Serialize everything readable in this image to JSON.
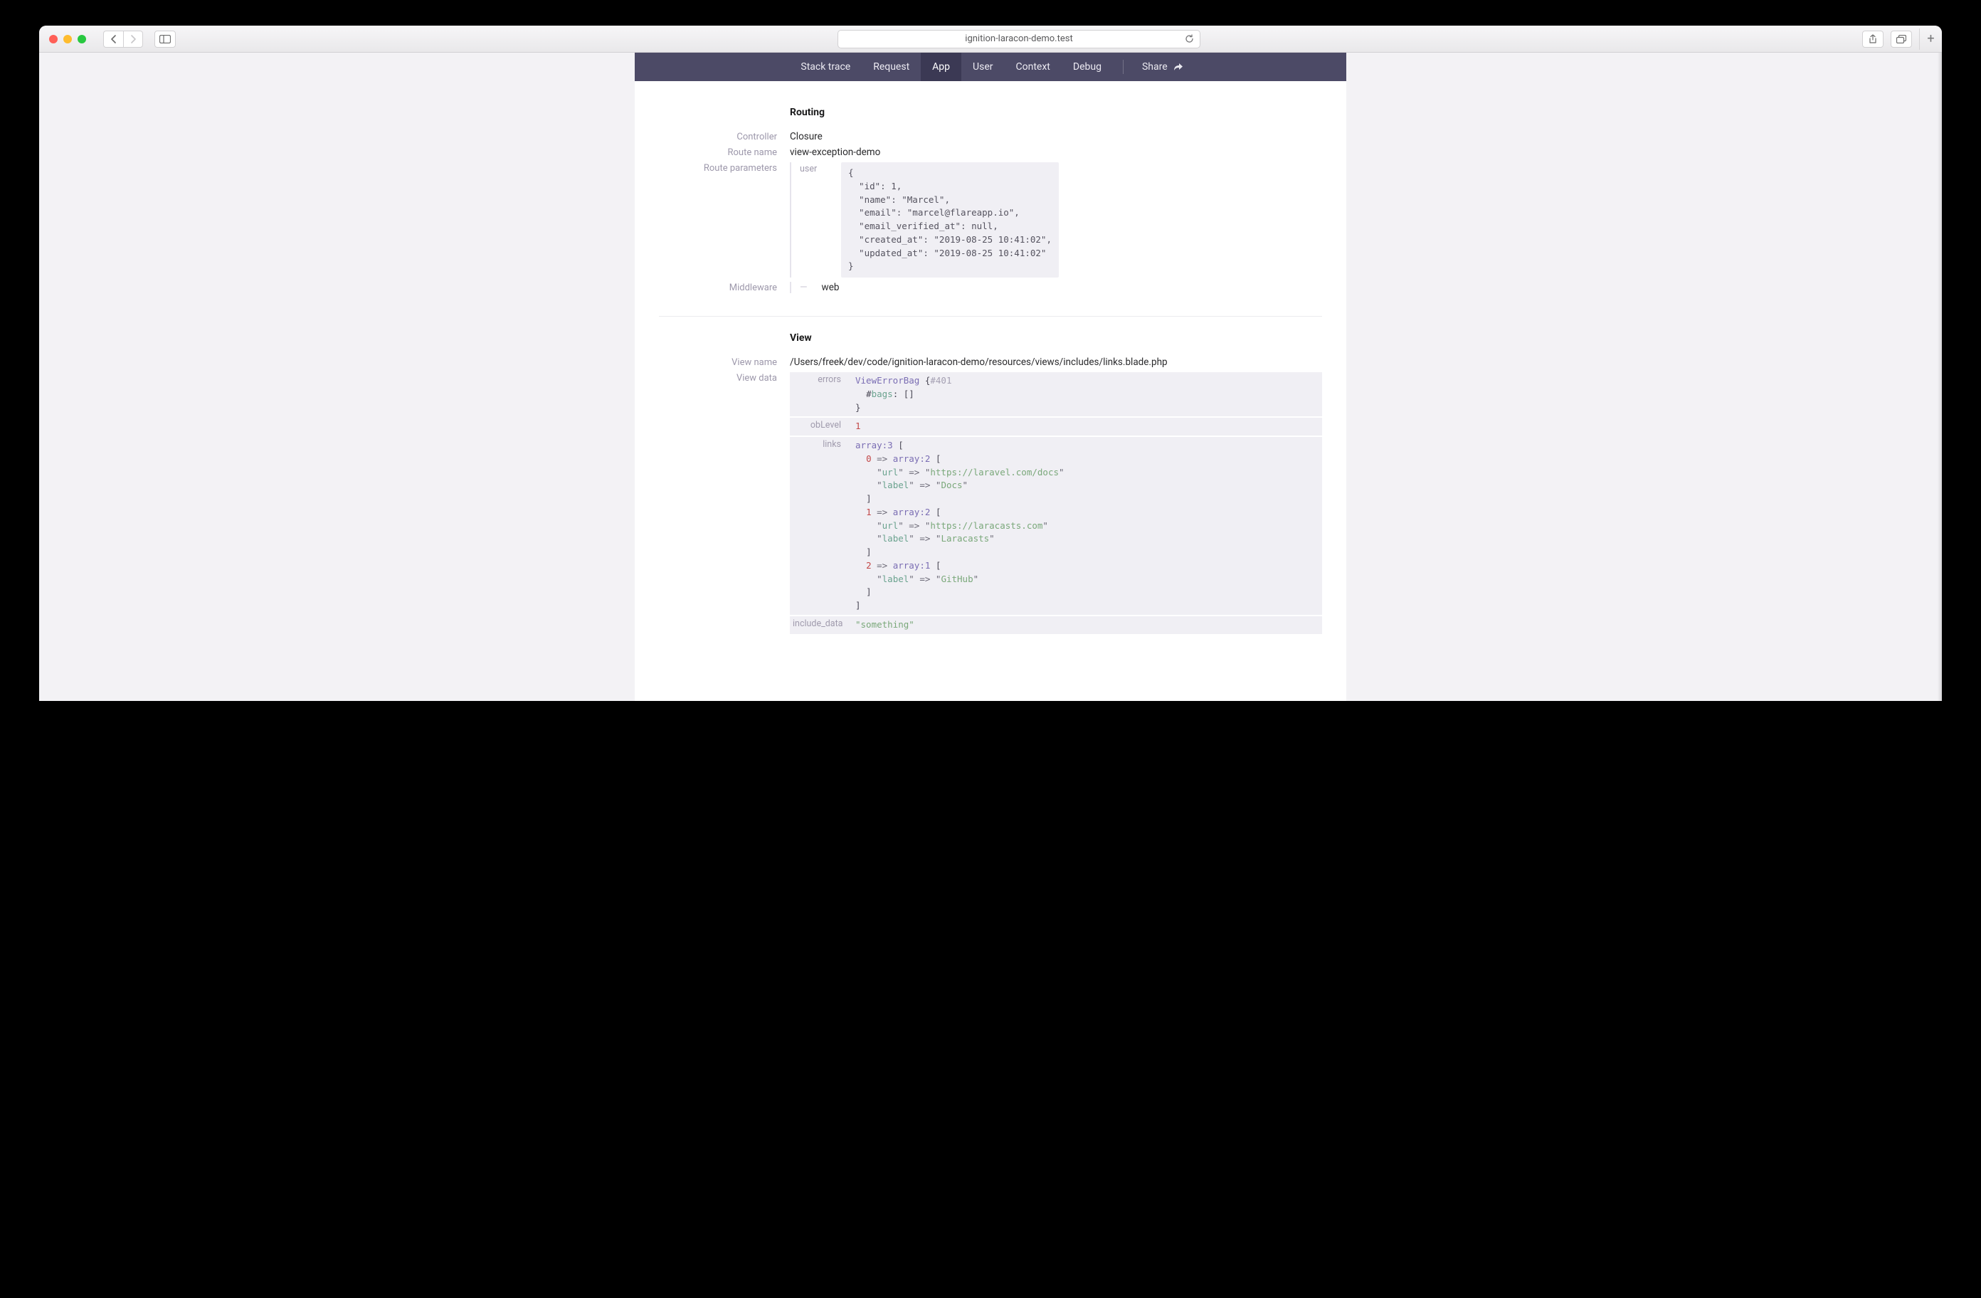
{
  "browser": {
    "url": "ignition-laracon-demo.test"
  },
  "nav": {
    "tabs": [
      {
        "label": "Stack trace",
        "active": false
      },
      {
        "label": "Request",
        "active": false
      },
      {
        "label": "App",
        "active": true
      },
      {
        "label": "User",
        "active": false
      },
      {
        "label": "Context",
        "active": false
      },
      {
        "label": "Debug",
        "active": false
      }
    ],
    "share": "Share"
  },
  "routing": {
    "title": "Routing",
    "labels": {
      "controller": "Controller",
      "route_name": "Route name",
      "route_parameters": "Route parameters",
      "middleware": "Middleware"
    },
    "controller": "Closure",
    "route_name": "view-exception-demo",
    "route_parameters_key": "user",
    "route_parameters_value": "{\n  \"id\": 1,\n  \"name\": \"Marcel\",\n  \"email\": \"marcel@flareapp.io\",\n  \"email_verified_at\": null,\n  \"created_at\": \"2019-08-25 10:41:02\",\n  \"updated_at\": \"2019-08-25 10:41:02\"\n}",
    "middleware_value": "web"
  },
  "view": {
    "title": "View",
    "labels": {
      "view_name": "View name",
      "view_data": "View data"
    },
    "view_name": "/Users/freek/dev/code/ignition-laracon-demo/resources/views/includes/links.blade.php",
    "data_keys": {
      "errors": "errors",
      "obLevel": "obLevel",
      "links": "links",
      "include_data": "include_data"
    },
    "errors": {
      "class": "ViewErrorBag",
      "hash": "#401",
      "bags_label": "bags",
      "bags_value": "[]"
    },
    "obLevel": "1",
    "links": {
      "count_label": "array:3",
      "items": [
        {
          "idx": "0",
          "count": "array:2",
          "url_key": "url",
          "url_val": "https://laravel.com/docs",
          "label_key": "label",
          "label_val": "Docs"
        },
        {
          "idx": "1",
          "count": "array:2",
          "url_key": "url",
          "url_val": "https://laracasts.com",
          "label_key": "label",
          "label_val": "Laracasts"
        },
        {
          "idx": "2",
          "count": "array:1",
          "label_key": "label",
          "label_val": "GitHub"
        }
      ]
    },
    "include_data": "\"something\""
  }
}
